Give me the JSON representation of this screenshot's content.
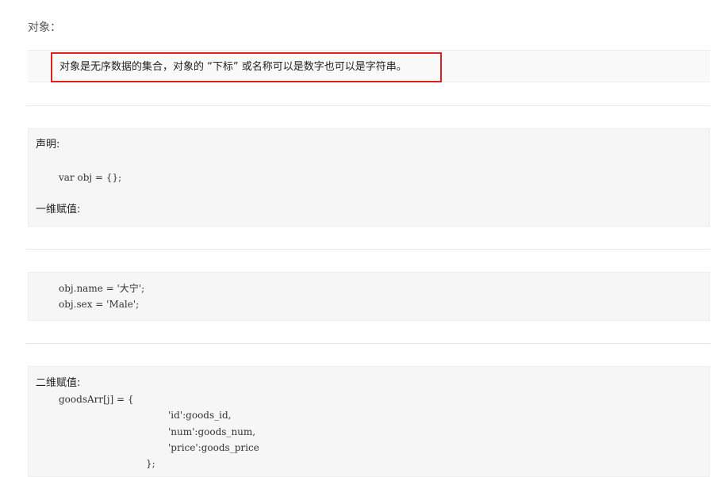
{
  "heading": "对象：",
  "definition": "对象是无序数据的集合，对象的 “下标” 或名称可以是数字也可以是字符串。",
  "block1": {
    "declare_label": "声明:",
    "declare_code": "var obj = {};",
    "one_dim_label": "一维赋值:"
  },
  "block2": {
    "line1": "obj.name = '大宁';",
    "line2": "obj.sex = 'Male';"
  },
  "block3": {
    "label": "二维赋值:",
    "line1": "goodsArr[j] = {",
    "line2": "'id':goods_id,",
    "line3": "'num':goods_num,",
    "line4": "'price':goods_price",
    "line5": "};"
  }
}
